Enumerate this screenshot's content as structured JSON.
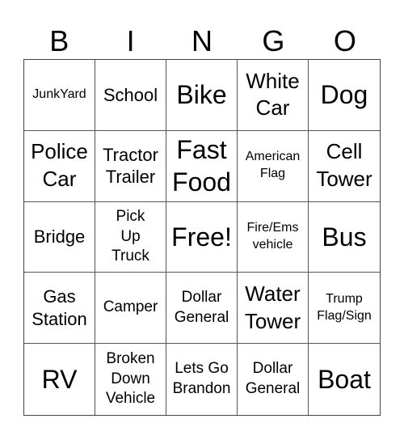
{
  "header": {
    "letters": [
      "B",
      "I",
      "N",
      "G",
      "O"
    ]
  },
  "grid": {
    "cells": [
      "JunkYard",
      "School",
      "Bike",
      "White\nCar",
      "Dog",
      "Police\nCar",
      "Tractor\nTrailer",
      "Fast\nFood",
      "American\nFlag",
      "Cell\nTower",
      "Bridge",
      "Pick\nUp\nTruck",
      "Free!",
      "Fire/Ems\nvehicle",
      "Bus",
      "Gas\nStation",
      "Camper",
      "Dollar\nGeneral",
      "Water\nTower",
      "Trump\nFlag/Sign",
      "RV",
      "Broken\nDown\nVehicle",
      "Lets Go\nBrandon",
      "Dollar\nGeneral",
      "Boat"
    ],
    "border_color": "#444444",
    "text_color": "#000000",
    "background_color": "#ffffff"
  }
}
